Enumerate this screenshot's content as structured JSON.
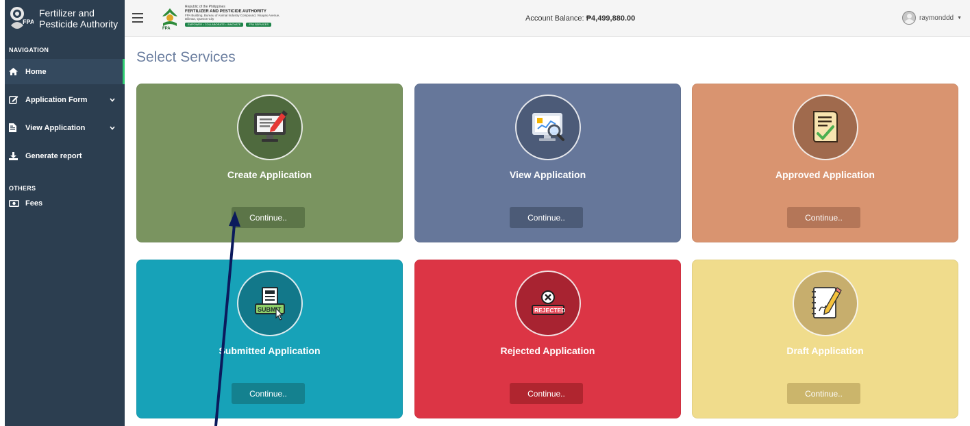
{
  "brand": {
    "name_line1": "Fertilizer and",
    "name_line2": "Pesticide Authority",
    "logo_text": "FPA"
  },
  "header": {
    "org_line1": "Republic of the Philippines",
    "org_line2": "FERTILIZER AND PESTICIDE AUTHORITY",
    "org_line3": "FPA Building, Bureau of Animal Industry Compound, Visayas Avenue, Diliman, Quezon City",
    "tag1": "EMPOWER • COLLABORATE • INNOVATE",
    "tag2": "FPA SERVICES",
    "balance_label": "Account Balance:",
    "balance_value": "₱4,499,880.00",
    "username": "raymonddd"
  },
  "sidebar": {
    "section_nav": "NAVIGATION",
    "section_others": "OTHERS",
    "items": [
      {
        "label": "Home",
        "icon": "home-icon"
      },
      {
        "label": "Application Form",
        "icon": "edit-icon"
      },
      {
        "label": "View Application",
        "icon": "file-icon"
      },
      {
        "label": "Generate report",
        "icon": "download-icon"
      }
    ],
    "others": [
      {
        "label": "Fees",
        "icon": "money-icon"
      }
    ]
  },
  "main": {
    "title": "Select Services",
    "cards": [
      {
        "title": "Create Application",
        "button": "Continue..",
        "icon": "monitor-edit-icon",
        "color": "#7a9460"
      },
      {
        "title": "View Application",
        "button": "Continue..",
        "icon": "monitor-search-icon",
        "color": "#66779a"
      },
      {
        "title": "Approved Application",
        "button": "Continue..",
        "icon": "approved-document-icon",
        "color": "#d99470"
      },
      {
        "title": "Submitted Application",
        "button": "Continue..",
        "icon": "submit-icon",
        "color": "#17a2b8"
      },
      {
        "title": "Rejected Application",
        "button": "Continue..",
        "icon": "rejected-icon",
        "color": "#dc3545"
      },
      {
        "title": "Draft Application",
        "button": "Continue..",
        "icon": "draft-note-icon",
        "color": "#f0dc8c"
      }
    ]
  }
}
